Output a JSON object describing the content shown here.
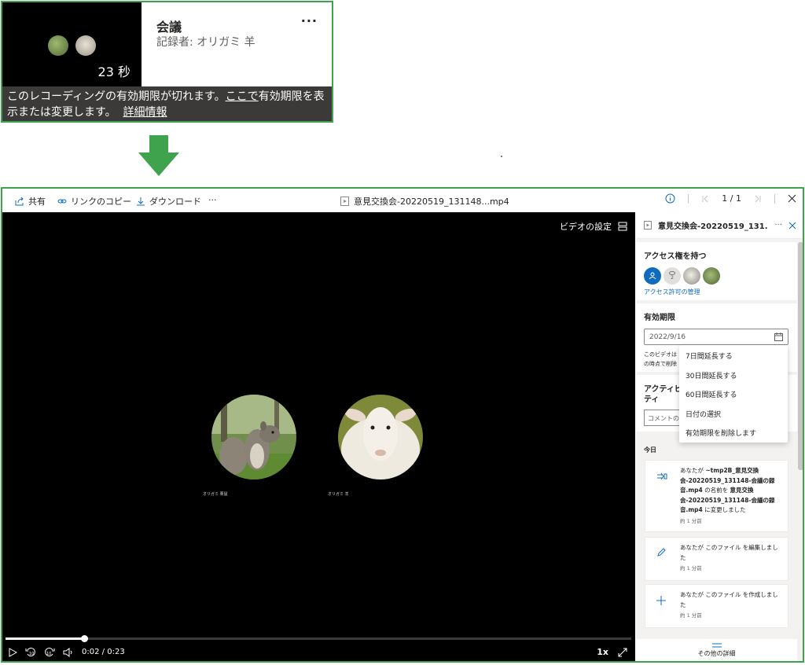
{
  "card": {
    "title": "会議",
    "recorder": "記録者: オリガミ 羊",
    "duration": "23 秒",
    "banner_part1": "このレコーディングの有効期限が切れます。",
    "banner_link_here": "ここで",
    "banner_part2": "有効期限を表示または変更します。",
    "banner_link_details": "詳細情報",
    "more": "..."
  },
  "toolbar": {
    "share": "共有",
    "copy_link": "リンクのコピー",
    "download": "ダウンロード",
    "more": "···",
    "file_title": "意見交換会-20220519_131148...mp4",
    "page_counter": "1 / 1"
  },
  "video": {
    "settings_label": "ビデオの設定",
    "participant1_name": "オリガミ 栗鼠",
    "participant2_name": "オリガミ 羊",
    "current_time": "0:02",
    "time_sep": "/",
    "total_time": "0:23",
    "speed": "1x",
    "progress": 0.125
  },
  "panel": {
    "file_name": "意見交換会-20220519_131...",
    "more": "···",
    "access_title": "アクセス権を持つ",
    "viewer_count": "2",
    "manage_access": "アクセス許可の管理",
    "expiry_title": "有効期限",
    "expiry_date": "2022/9/16",
    "expiry_note_line1": "このビデオは",
    "expiry_note_line2": "の時点で削除",
    "activity_title_1": "アクティビ",
    "activity_title_2": "ティ",
    "comment_placeholder": "コメントの",
    "today": "今日",
    "act1_a": "あなたが ",
    "act1_b": "~tmp2B_意見交換会-20220519_131148-会議の録音.mp4",
    "act1_c": " の名前を ",
    "act1_d": "意見交換会-20220519_131148-会議の録音.mp4",
    "act1_e": " に変更しました",
    "act1_time": "約 1 分前",
    "act2_a": "あなたが ",
    "act2_b": "このファイル",
    "act2_c": " を編集しました",
    "act2_time": "約 1 分前",
    "act3_a": "あなたが ",
    "act3_b": "このファイル",
    "act3_c": " を作成しました",
    "act3_time": "約 1 分前",
    "more_details": "その他の詳細"
  },
  "dropdown": {
    "items": [
      "7日間延長する",
      "30日間延長する",
      "60日間延長する",
      "日付の選択",
      "有効期限を削除します"
    ]
  },
  "colors": {
    "frame_border": "#3fa34d",
    "arrow": "#3fa34d",
    "accent": "#0f6cbd"
  }
}
